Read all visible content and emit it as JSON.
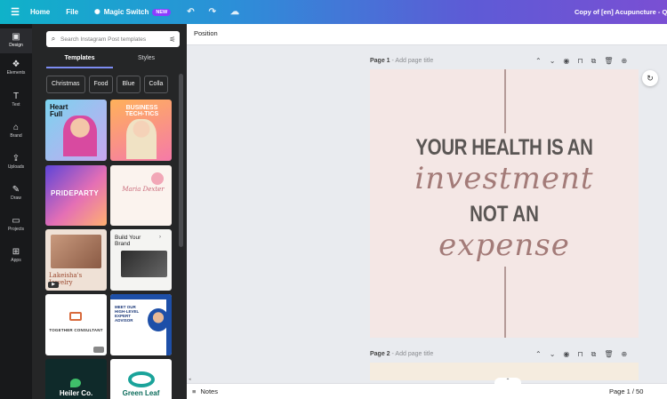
{
  "topbar": {
    "home": "Home",
    "file": "File",
    "magic_switch": "Magic Switch",
    "magic_badge": "NEW",
    "doc_title": "Copy of [en] Acupuncture - Quo"
  },
  "rail": {
    "items": [
      {
        "label": "Design",
        "icon": "▣"
      },
      {
        "label": "Elements",
        "icon": "❖"
      },
      {
        "label": "Text",
        "icon": "T"
      },
      {
        "label": "Brand",
        "icon": "⌂"
      },
      {
        "label": "Uploads",
        "icon": "⇪"
      },
      {
        "label": "Draw",
        "icon": "✎"
      },
      {
        "label": "Projects",
        "icon": "▭"
      },
      {
        "label": "Apps",
        "icon": "⊞"
      }
    ]
  },
  "panel": {
    "search_placeholder": "Search Instagram Post templates",
    "tabs": [
      "Templates",
      "Styles"
    ],
    "chips": [
      "Christmas",
      "Food",
      "Blue",
      "Colla"
    ],
    "thumbs": {
      "t1": "Heart Full",
      "t2": "BUSINESS TECH-TICS",
      "t3": "PRIDEPARTY",
      "t4": "Maria Dexter",
      "t5": "Lakeisha's Jewelry",
      "t6": "Build Your Brand",
      "t7": "TOGETHER CONSULTANT",
      "t8": "MEET OUR HIGH-LEVEL EXPERT ADVISOR",
      "t9": "Heiler Co.",
      "t10": "Green Leaf"
    }
  },
  "context": {
    "position": "Position"
  },
  "pages": {
    "p1_label": "Page 1",
    "p1_sub": "- Add page title",
    "p2_label": "Page 2",
    "p2_sub": "- Add page title"
  },
  "design": {
    "line1": "YOUR HEALTH IS AN",
    "line2": "investment",
    "line3": "NOT AN",
    "line4": "expense"
  },
  "bottom": {
    "notes": "Notes",
    "pager": "Page 1 / 50"
  }
}
